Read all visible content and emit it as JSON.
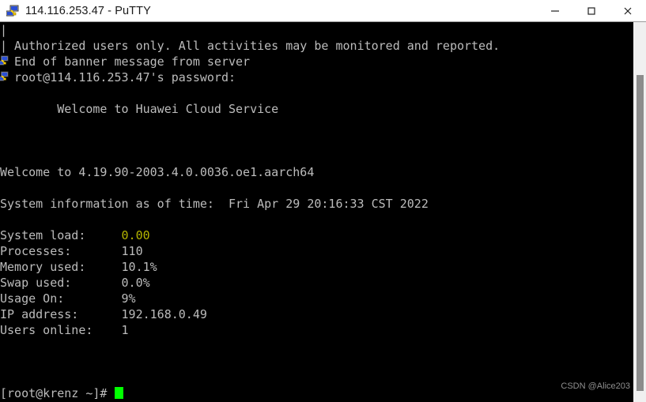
{
  "window": {
    "title": "114.116.253.47 - PuTTY",
    "icon": "putty-computer-icon",
    "controls": {
      "minimize": "minimize-button",
      "maximize": "maximize-button",
      "close": "close-button"
    }
  },
  "terminal": {
    "background_color": "#000000",
    "foreground_color": "#bcbcbc",
    "accent_yellow": "#b5b500",
    "cursor_color": "#00ff00",
    "lines": [
      {
        "text": "|"
      },
      {
        "text": "| Authorized users only. All activities may be monitored and reported."
      },
      {
        "text": "  End of banner message from server",
        "edge_icon": "putty-computer-icon"
      },
      {
        "text": "  root@114.116.253.47's password:",
        "edge_icon": "putty-computer-icon"
      },
      {
        "text": ""
      },
      {
        "text": "        Welcome to Huawei Cloud Service"
      },
      {
        "text": ""
      },
      {
        "text": ""
      },
      {
        "text": ""
      },
      {
        "text": "Welcome to 4.19.90-2003.4.0.0036.oe1.aarch64"
      },
      {
        "text": ""
      },
      {
        "text": "System information as of time:  Fri Apr 29 20:16:33 CST 2022"
      },
      {
        "text": ""
      },
      {
        "label": "System load:",
        "value": "0.00",
        "value_color": "yellow"
      },
      {
        "label": "Processes:",
        "value": "110"
      },
      {
        "label": "Memory used:",
        "value": "10.1%"
      },
      {
        "label": "Swap used:",
        "value": "0.0%"
      },
      {
        "label": "Usage On:",
        "value": "9%"
      },
      {
        "label": "IP address:",
        "value": "192.168.0.49"
      },
      {
        "label": "Users online:",
        "value": "1"
      },
      {
        "text": ""
      },
      {
        "text": ""
      },
      {
        "text": ""
      },
      {
        "prompt": "[root@krenz ~]# ",
        "cursor": true
      }
    ]
  },
  "scrollbar": {
    "name": "vertical-scrollbar",
    "thumb": "scrollbar-thumb"
  },
  "watermark": {
    "text": "CSDN @Alice203"
  }
}
